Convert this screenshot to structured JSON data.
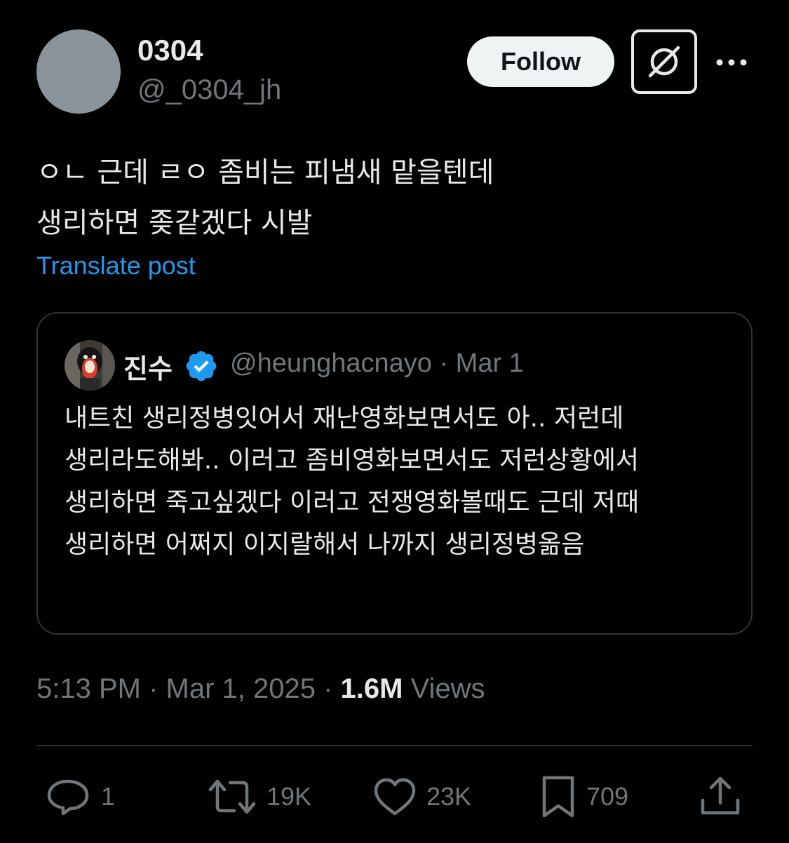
{
  "author": {
    "display_name": "0304",
    "handle": "@_0304_jh"
  },
  "header": {
    "follow_label": "Follow",
    "grok_icon": "grok-icon",
    "more_icon": "more-icon"
  },
  "post": {
    "text": "ㅇㄴ 근데 ㄹㅇ 좀비는 피냄새 맡을텐데\n생리하면 좆같겠다 시발",
    "translate_label": "Translate post"
  },
  "quote": {
    "display_name": "진수",
    "handle_date": "@heunghacnayo · Mar 1",
    "text": "내트친 생리정병잇어서 재난영화보면서도 아.. 저런데 생리라도해봐.. 이러고 좀비영화보면서도 저런상황에서 생리하면 죽고싶겠다 이러고 전쟁영화볼때도 근데 저때 생리하면 어쩌지 이지랄해서 나까지 생리정병옮음",
    "verified_color": "#1d9bf0"
  },
  "meta": {
    "time_date": "5:13 PM · Mar 1, 2025 · ",
    "views_count": "1.6M",
    "views_label": " Views"
  },
  "actions": {
    "replies": "1",
    "reposts": "19K",
    "likes": "23K",
    "bookmarks": "709"
  },
  "colors": {
    "background": "#000000",
    "text_primary": "#e7e9ea",
    "text_secondary": "#71767b",
    "link": "#1d9bf0",
    "border": "#2f3336"
  }
}
